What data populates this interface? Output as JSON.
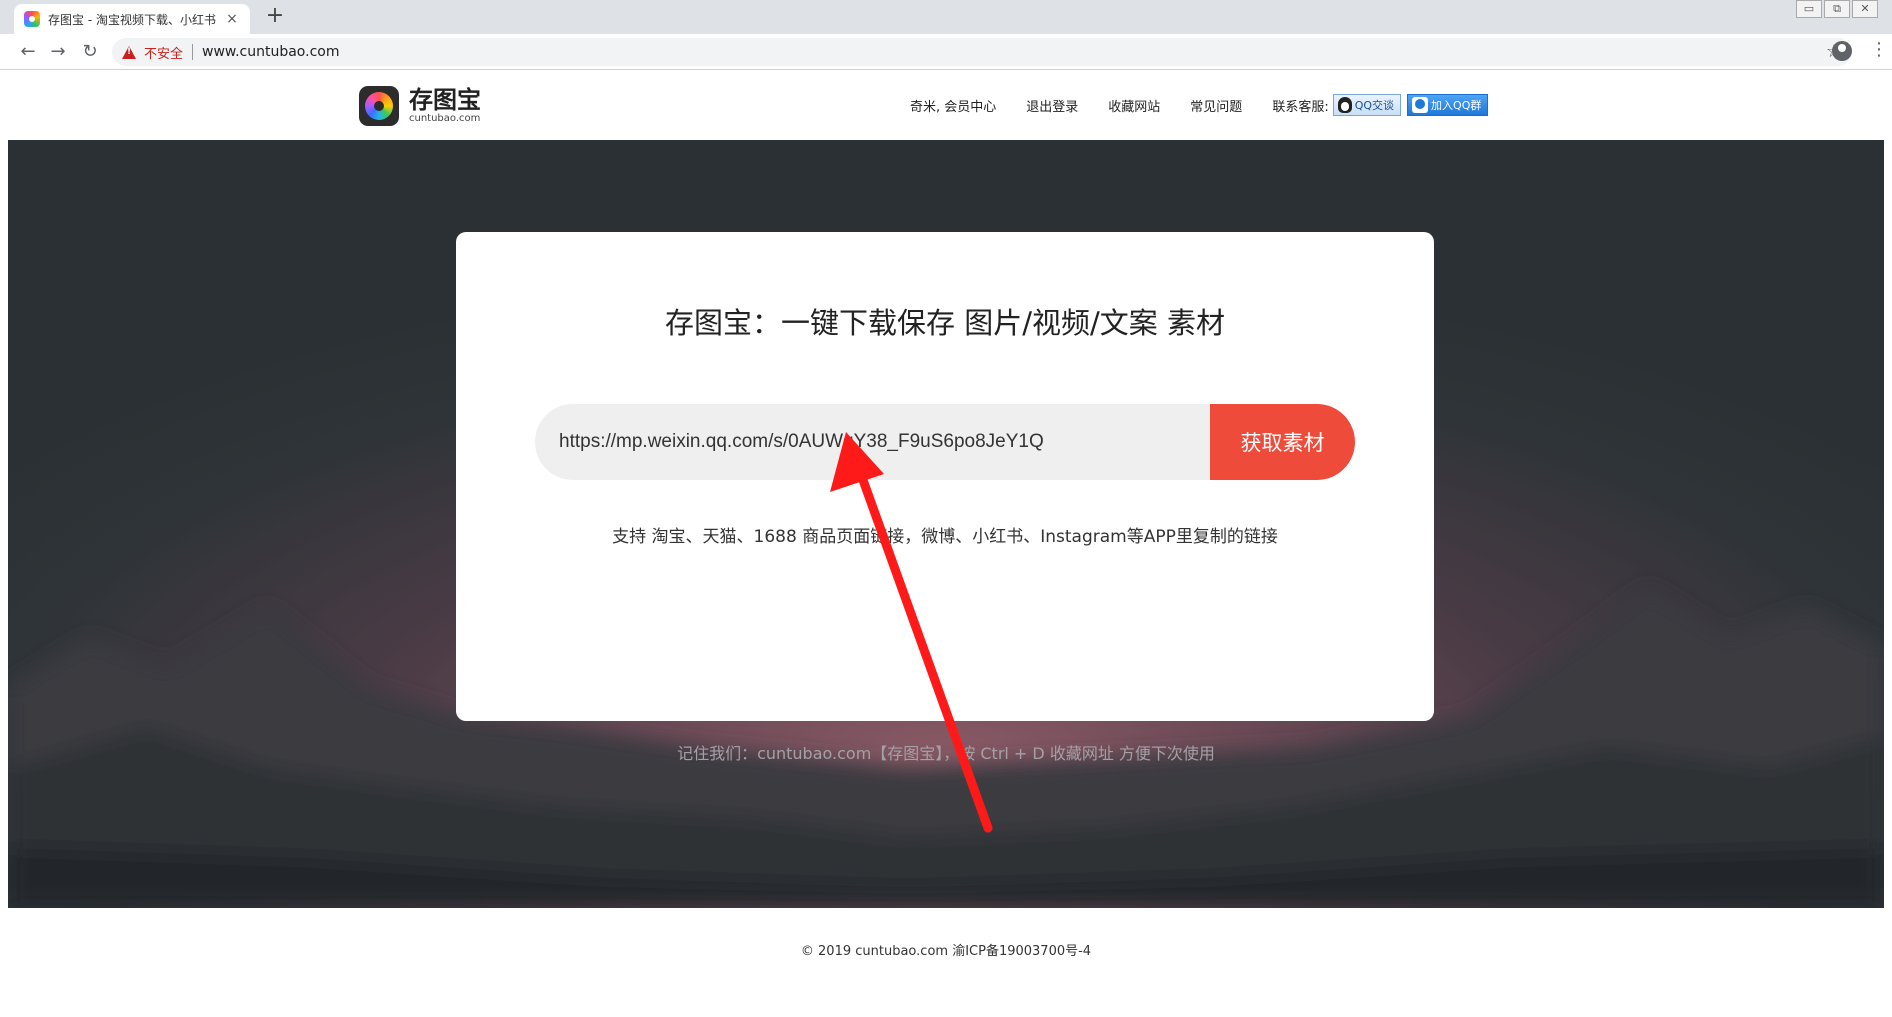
{
  "browser": {
    "tab_title": "存图宝 - 淘宝视频下载、小红书",
    "tab_close": "×",
    "new_tab": "+",
    "window_controls": [
      "▭",
      "⧉",
      "✕"
    ],
    "back": "←",
    "forward": "→",
    "reload": "↻",
    "security_label": "不安全",
    "url": "www.cuntubao.com",
    "bookmark_icon": "☆",
    "menu_icon": "⋮"
  },
  "site": {
    "logo_name": "存图宝",
    "logo_domain": "cuntubao.com",
    "nav": {
      "user_center": "奇米, 会员中心",
      "logout": "退出登录",
      "bookmark_site": "收藏网站",
      "faq": "常见问题",
      "contact_label": "联系客服:",
      "qq_chat": "QQ交谈",
      "join_qq_group": "加入QQ群"
    }
  },
  "hero": {
    "title": "存图宝：一键下载保存 图片/视频/文案 素材",
    "input_value": "https://mp.weixin.qq.com/s/0AUWgY38_F9uS6po8JeY1Q",
    "fetch_button": "获取素材",
    "support_text": "支持 淘宝、天猫、1688 商品页面链接，微博、小红书、Instagram等APP里复制的链接",
    "remember_text": "记住我们：cuntubao.com【存图宝】，按 Ctrl + D 收藏网址 方便下次使用"
  },
  "footer": {
    "copyright": "© 2019 cuntubao.com 渝ICP备19003700号-4"
  },
  "colors": {
    "accent_red": "#ef4b3a",
    "annotation_arrow": "#ff1a1a"
  }
}
